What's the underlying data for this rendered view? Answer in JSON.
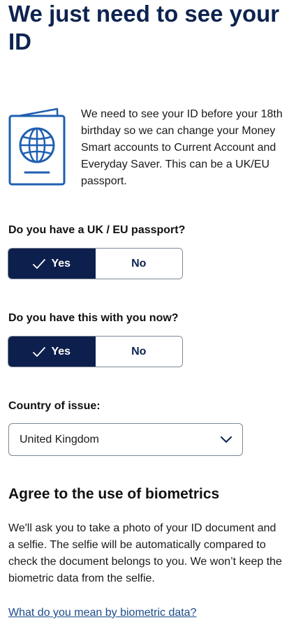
{
  "page": {
    "title": "We just need to see your ID"
  },
  "intro": {
    "icon": "passport-icon",
    "text": "We need to see your ID before your 18th birthday so we can change your Money Smart accounts to Current Account and Everyday Saver. This can be a UK/EU passport."
  },
  "passport_question": {
    "label": "Do you have a UK / EU passport?",
    "yes_label": "Yes",
    "no_label": "No",
    "selected": "Yes"
  },
  "with_you_question": {
    "label": "Do you have this with you now?",
    "yes_label": "Yes",
    "no_label": "No",
    "selected": "Yes"
  },
  "country": {
    "label": "Country of issue:",
    "value": "United Kingdom"
  },
  "biometrics": {
    "heading": "Agree to the use of biometrics",
    "text": "We'll ask you to take a photo of your ID document and a selfie. The selfie will be automatically compared to check the document belongs to you. We won’t keep the biometric data from the selfie.",
    "link_text": "What do you mean by biometric data?"
  },
  "colors": {
    "primary_dark": "#0d1f4c",
    "title_navy": "#0d2350",
    "icon_blue": "#1f5fb0",
    "link_blue": "#1a4a8a",
    "border_grey": "#7c8796"
  }
}
